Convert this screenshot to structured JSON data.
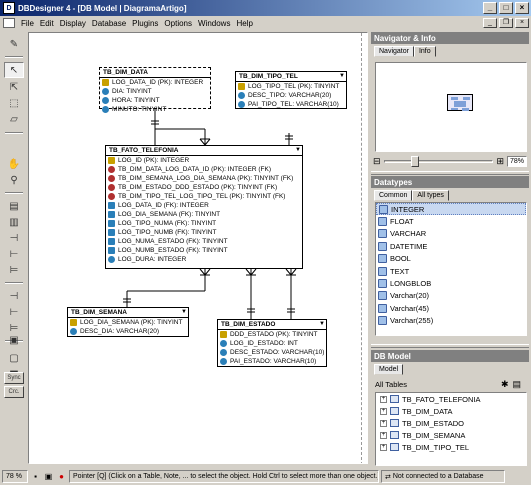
{
  "window": {
    "title": "DBDesigner 4 - [DB Model | DiagramaArtigo]"
  },
  "menu": [
    "File",
    "Edit",
    "Display",
    "Database",
    "Plugins",
    "Options",
    "Windows",
    "Help"
  ],
  "toolbar": {
    "sync_label": "Sync",
    "crc_label": "Crc."
  },
  "entities": [
    {
      "id": "data",
      "title": "TB_DIM_DATA",
      "columns": [
        {
          "icon": "key",
          "text": "LOG_DATA_ID (PK): INTEGER"
        },
        {
          "icon": "col",
          "text": "DIA: TINYINT"
        },
        {
          "icon": "col",
          "text": "HORA: TINYINT"
        },
        {
          "icon": "col",
          "text": "MINUTO: TINYINT"
        }
      ]
    },
    {
      "id": "tipotel",
      "title": "TB_DIM_TIPO_TEL",
      "columns": [
        {
          "icon": "key",
          "text": "LOG_TIPO_TEL (PK): TINYINT"
        },
        {
          "icon": "col",
          "text": "DESC_TIPO: VARCHAR(20)"
        },
        {
          "icon": "col",
          "text": "PAI_TIPO_TEL: VARCHAR(10)"
        }
      ]
    },
    {
      "id": "fato",
      "title": "TB_FATO_TELEFONIA",
      "columns": [
        {
          "icon": "key",
          "text": "LOG_ID (PK): INTEGER"
        },
        {
          "icon": "fk",
          "text": "TB_DIM_DATA_LOG_DATA_ID (PK): INTEGER (FK)"
        },
        {
          "icon": "fk",
          "text": "TB_DIM_SEMANA_LOG_DIA_SEMANA (PK): TINYINT (FK)"
        },
        {
          "icon": "fk",
          "text": "TB_DIM_ESTADO_DDD_ESTADO (PK): TINYINT (FK)"
        },
        {
          "icon": "fk",
          "text": "TB_DIM_TIPO_TEL_LOG_TIPO_TEL (PK): TINYINT (FK)"
        },
        {
          "icon": "idx",
          "text": "LOG_DATA_ID (FK): INTEGER"
        },
        {
          "icon": "idx",
          "text": "LOG_DIA_SEMANA (FK): TINYINT"
        },
        {
          "icon": "idx",
          "text": "LOG_TIPO_NUMA (FK): TINYINT"
        },
        {
          "icon": "idx",
          "text": "LOG_TIPO_NUMB (FK): TINYINT"
        },
        {
          "icon": "idx",
          "text": "LOG_NUMA_ESTADO (FK): TINYINT"
        },
        {
          "icon": "idx",
          "text": "LOG_NUMB_ESTADO (FK): TINYINT"
        },
        {
          "icon": "col",
          "text": "LOG_DURA: INTEGER"
        }
      ]
    },
    {
      "id": "semana",
      "title": "TB_DIM_SEMANA",
      "columns": [
        {
          "icon": "key",
          "text": "LOG_DIA_SEMANA (PK): TINYINT"
        },
        {
          "icon": "col",
          "text": "DESC_DIA: VARCHAR(20)"
        }
      ]
    },
    {
      "id": "estado",
      "title": "TB_DIM_ESTADO",
      "columns": [
        {
          "icon": "key",
          "text": "DDD_ESTADO (PK): TINYINT"
        },
        {
          "icon": "col",
          "text": "LOG_ID_ESTADO: INT"
        },
        {
          "icon": "col",
          "text": "DESC_ESTADO: VARCHAR(10)"
        },
        {
          "icon": "col",
          "text": "PAI_ESTADO: VARCHAR(10)"
        }
      ]
    }
  ],
  "navigator": {
    "header": "Navigator & Info",
    "tabs": [
      "Navigator",
      "Info"
    ],
    "zoom": "78%"
  },
  "datatypes": {
    "header": "Datatypes",
    "tabs": [
      "Common",
      "All types"
    ],
    "items": [
      "INTEGER",
      "FLOAT",
      "VARCHAR",
      "DATETIME",
      "BOOL",
      "TEXT",
      "LONGBLOB",
      "Varchar(20)",
      "Varchar(45)",
      "Varchar(255)"
    ]
  },
  "dbmodel": {
    "header": "DB Model",
    "tab": "Model",
    "all_tables": "All Tables",
    "tables": [
      "TB_FATO_TELEFONIA",
      "TB_DIM_DATA",
      "TB_DIM_ESTADO",
      "TB_DIM_SEMANA",
      "TB_DIM_TIPO_TEL"
    ]
  },
  "status": {
    "zoom": "78 %",
    "message": "Pointer [Q] (Click on a Table, Note, ... to select the object. Hold Ctrl to select more than one object.)",
    "connection": "Not connected to a Database"
  }
}
